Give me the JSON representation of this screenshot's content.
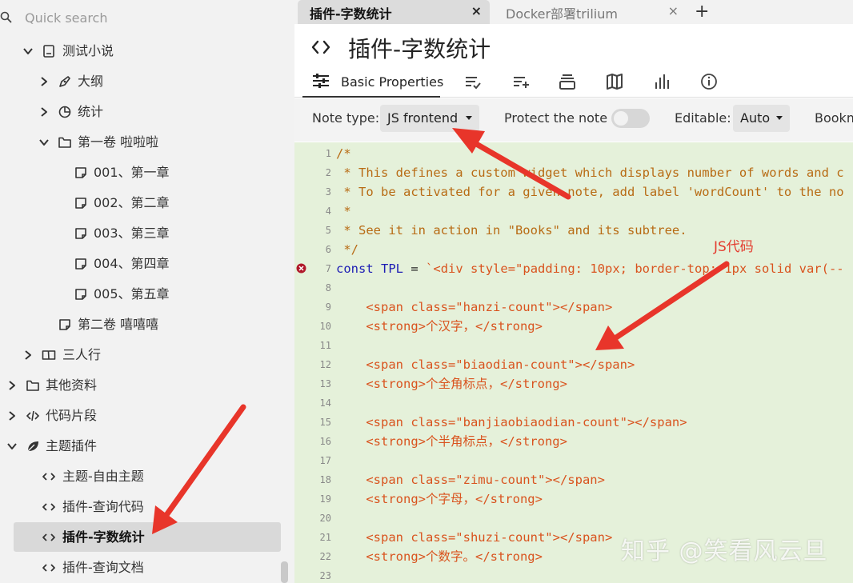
{
  "search": {
    "placeholder": "Quick search"
  },
  "tree": [
    {
      "label": "测试小说",
      "icon": "book-note-icon",
      "arrow": "down"
    },
    {
      "label": "大纲",
      "icon": "pen-icon",
      "arrow": "right"
    },
    {
      "label": "统计",
      "icon": "pie-chart-icon",
      "arrow": "right"
    },
    {
      "label": "第一卷 啦啦啦",
      "icon": "folder-icon",
      "arrow": "down"
    },
    {
      "label": "001、第一章",
      "icon": "note-icon",
      "arrow": ""
    },
    {
      "label": "002、第二章",
      "icon": "note-icon",
      "arrow": ""
    },
    {
      "label": "003、第三章",
      "icon": "note-icon",
      "arrow": ""
    },
    {
      "label": "004、第四章",
      "icon": "note-icon",
      "arrow": ""
    },
    {
      "label": "005、第五章",
      "icon": "note-icon",
      "arrow": ""
    },
    {
      "label": "第二卷 嘻嘻嘻",
      "icon": "note-icon",
      "arrow": ""
    },
    {
      "label": "三人行",
      "icon": "open-book-icon",
      "arrow": "right"
    },
    {
      "label": "其他资料",
      "icon": "folder-icon",
      "arrow": "right"
    },
    {
      "label": "代码片段",
      "icon": "code-icon",
      "arrow": "right"
    },
    {
      "label": "主题插件",
      "icon": "leaf-icon",
      "arrow": "down"
    },
    {
      "label": "主题-自由主题",
      "icon": "code-brackets-icon",
      "arrow": ""
    },
    {
      "label": "插件-查询代码",
      "icon": "code-brackets-icon",
      "arrow": ""
    },
    {
      "label": "插件-字数统计",
      "icon": "code-brackets-icon",
      "arrow": "",
      "active": true
    },
    {
      "label": "插件-查询文档",
      "icon": "code-brackets-icon",
      "arrow": ""
    }
  ],
  "tabs": [
    {
      "label": "插件-字数统计",
      "close": "×",
      "active": true
    },
    {
      "label": "Docker部署trilium",
      "close": "×",
      "active": false
    }
  ],
  "tab_add": "+",
  "note": {
    "title": "插件-字数统计"
  },
  "ribbon": {
    "active_tab": "Basic Properties",
    "icons": [
      "edited-notes-icon",
      "promoted-attributes-icon",
      "attachments-icon",
      "book-icon",
      "stats-icon",
      "info-icon"
    ]
  },
  "props": {
    "note_type_label": "Note type:",
    "note_type_value": "JS frontend",
    "protect_label": "Protect the note",
    "editable_label": "Editable:",
    "editable_value": "Auto",
    "bookmark_label": "Bookm"
  },
  "code": {
    "line_numbers": [
      "1",
      "2",
      "3",
      "4",
      "5",
      "6",
      "7",
      "8",
      "9",
      "10",
      "11",
      "12",
      "13",
      "14",
      "15",
      "16",
      "17",
      "18",
      "19",
      "20",
      "21",
      "22",
      "23"
    ],
    "lines": [
      "/*",
      " * This defines a custom widget which displays number of words and c",
      " * To be activated for a given note, add label 'wordCount' to the no",
      " *",
      " * See it in action in \"Books\" and its subtree.",
      " */",
      "const TPL = `<div style=\"padding: 10px; border-top: 1px solid var(--",
      "",
      "    <span class=\"hanzi-count\"></span>",
      "    <strong>个汉字，</strong>",
      "",
      "    <span class=\"biaodian-count\"></span>",
      "    <strong>个全角标点，</strong>",
      "",
      "    <span class=\"banjiaobiaodian-count\"></span>",
      "    <strong>个半角标点，</strong>",
      "",
      "    <span class=\"zimu-count\"></span>",
      "    <strong>个字母，</strong>",
      "",
      "    <span class=\"shuzi-count\"></span>",
      "    <strong>个数字。</strong>",
      ""
    ]
  },
  "annotations": {
    "js_code_label": "JS代码"
  },
  "watermark": "知乎 @笑看风云旦",
  "colors": {
    "arrow": "#e8352a",
    "editor_bg": "#e5f1da",
    "active_row": "#d9d9d9"
  }
}
